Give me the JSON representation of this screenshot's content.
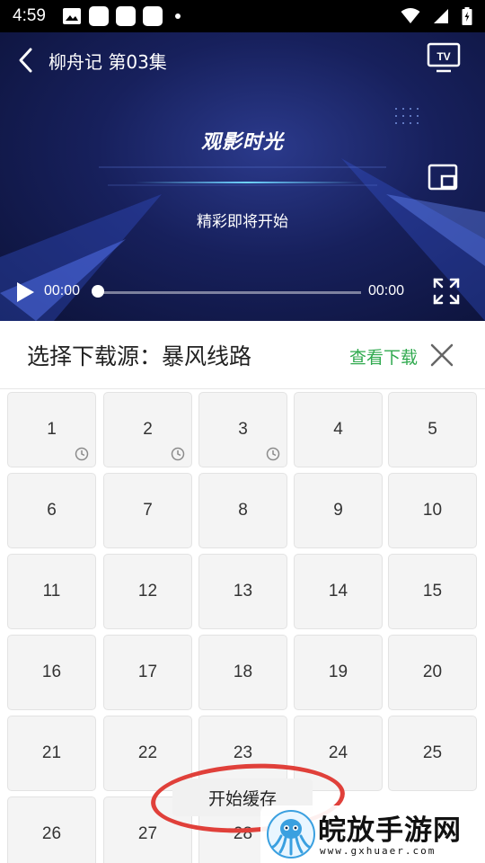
{
  "status_bar": {
    "time": "4:59"
  },
  "player": {
    "title": "柳舟记 第03集",
    "brand_text": "观影时光",
    "slogan": "精彩即将开始",
    "current_time": "00:00",
    "total_time": "00:00",
    "progress": 0
  },
  "download_panel": {
    "title": "选择下载源：暴风线路",
    "view_downloads": "查看下载",
    "accent_color": "#2fa94e"
  },
  "episodes": [
    {
      "label": "1",
      "downloading": true
    },
    {
      "label": "2",
      "downloading": true
    },
    {
      "label": "3",
      "downloading": true
    },
    {
      "label": "4",
      "downloading": false
    },
    {
      "label": "5",
      "downloading": false
    },
    {
      "label": "6",
      "downloading": false
    },
    {
      "label": "7",
      "downloading": false
    },
    {
      "label": "8",
      "downloading": false
    },
    {
      "label": "9",
      "downloading": false
    },
    {
      "label": "10",
      "downloading": false
    },
    {
      "label": "11",
      "downloading": false
    },
    {
      "label": "12",
      "downloading": false
    },
    {
      "label": "13",
      "downloading": false
    },
    {
      "label": "14",
      "downloading": false
    },
    {
      "label": "15",
      "downloading": false
    },
    {
      "label": "16",
      "downloading": false
    },
    {
      "label": "17",
      "downloading": false
    },
    {
      "label": "18",
      "downloading": false
    },
    {
      "label": "19",
      "downloading": false
    },
    {
      "label": "20",
      "downloading": false
    },
    {
      "label": "21",
      "downloading": false
    },
    {
      "label": "22",
      "downloading": false
    },
    {
      "label": "23",
      "downloading": false
    },
    {
      "label": "24",
      "downloading": false
    },
    {
      "label": "25",
      "downloading": false
    },
    {
      "label": "26",
      "downloading": false
    },
    {
      "label": "27",
      "downloading": false
    },
    {
      "label": "28",
      "downloading": false
    }
  ],
  "start_cache_button": "开始缓存",
  "watermark": {
    "title": "皖放手游网",
    "url": "www.gxhuaer.com"
  }
}
